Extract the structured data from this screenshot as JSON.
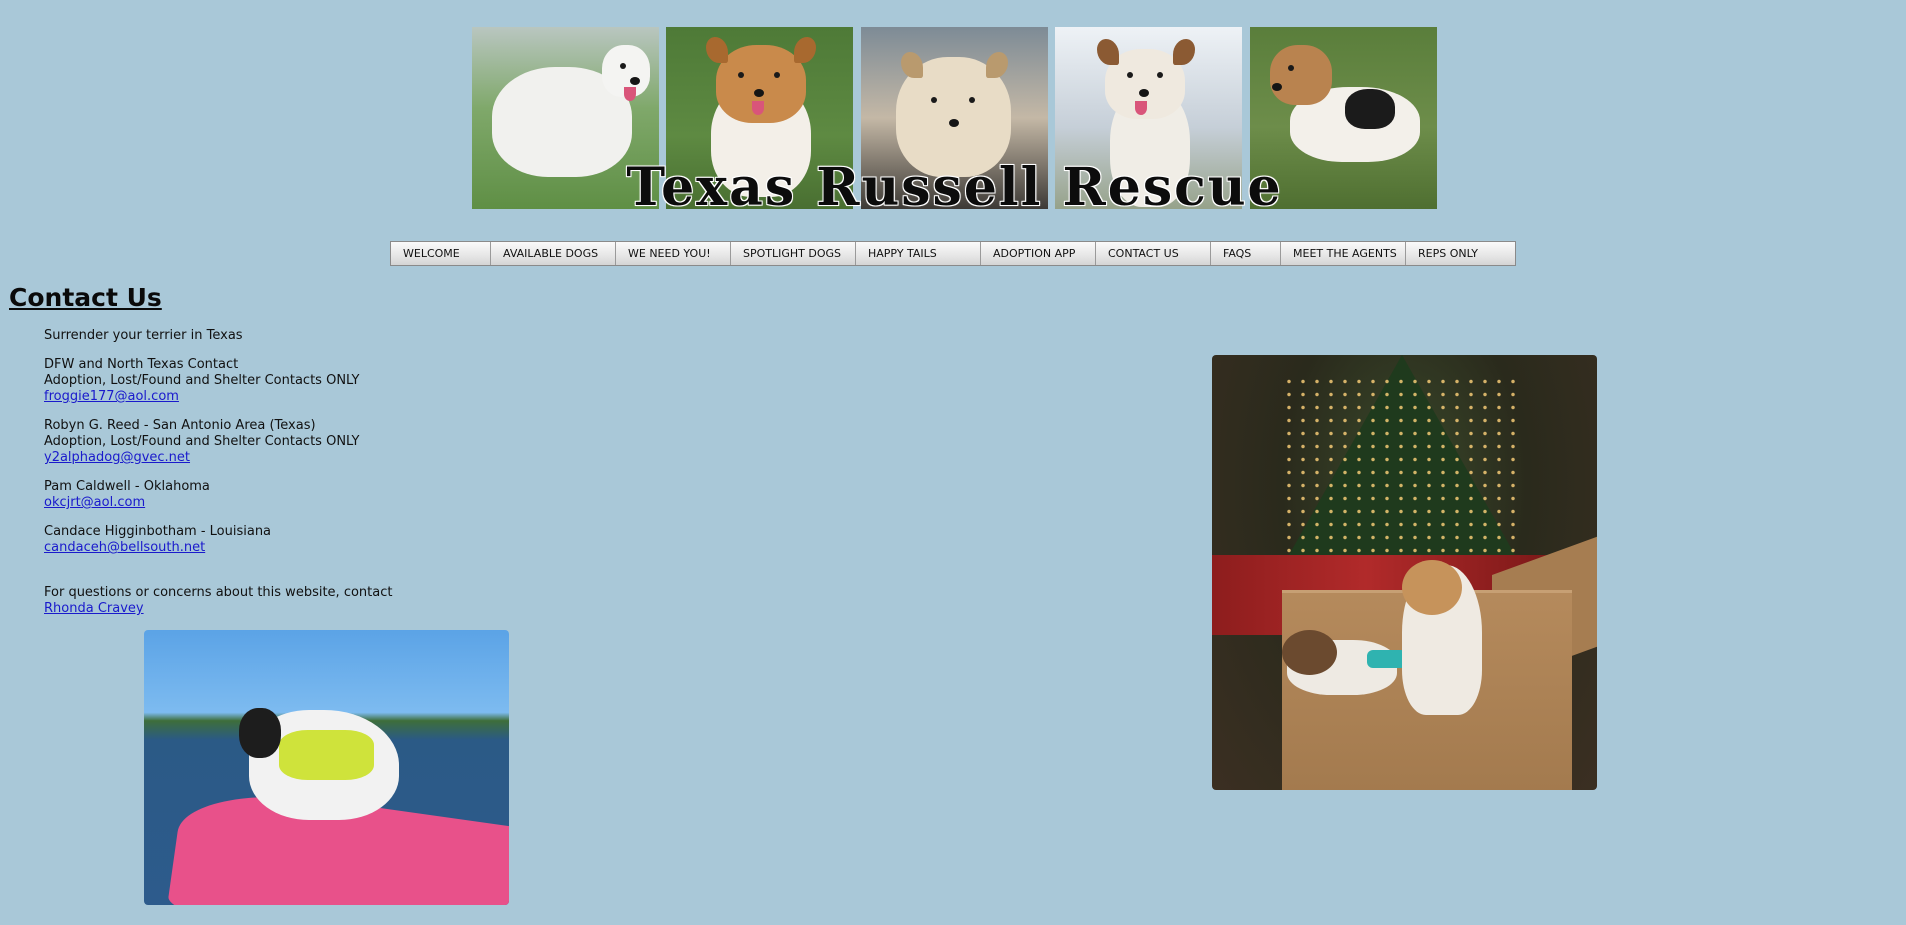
{
  "site": {
    "banner_title": "Texas Russell Rescue"
  },
  "nav": {
    "items": [
      {
        "label": "WELCOME"
      },
      {
        "label": "AVAILABLE DOGS"
      },
      {
        "label": "WE NEED YOU!"
      },
      {
        "label": "SPOTLIGHT DOGS"
      },
      {
        "label": "HAPPY TAILS"
      },
      {
        "label": "ADOPTION APP"
      },
      {
        "label": "CONTACT US"
      },
      {
        "label": "FAQS"
      },
      {
        "label": "MEET THE AGENTS"
      },
      {
        "label": "REPS ONLY"
      }
    ]
  },
  "main": {
    "title": "Contact Us",
    "intro": "Surrender your terrier in Texas",
    "contacts": [
      {
        "line1": "DFW and North Texas Contact",
        "line2": "Adoption, Lost/Found and Shelter Contacts ONLY",
        "email": "froggie177@aol.com"
      },
      {
        "line1": "Robyn G. Reed - San Antonio Area (Texas)",
        "line2": "Adoption, Lost/Found and Shelter Contacts ONLY",
        "email": "y2alphadog@gvec.net"
      },
      {
        "line1": "Pam Caldwell - Oklahoma",
        "email": "okcjrt@aol.com"
      },
      {
        "line1": "Candace Higginbotham - Louisiana",
        "email": "candaceh@bellsouth.net"
      }
    ],
    "website_note": "For questions or concerns about this website, contact",
    "website_contact": "Rhonda Cravey"
  },
  "colors": {
    "page_background": "#a9c8d8",
    "link": "#1a1acc"
  }
}
